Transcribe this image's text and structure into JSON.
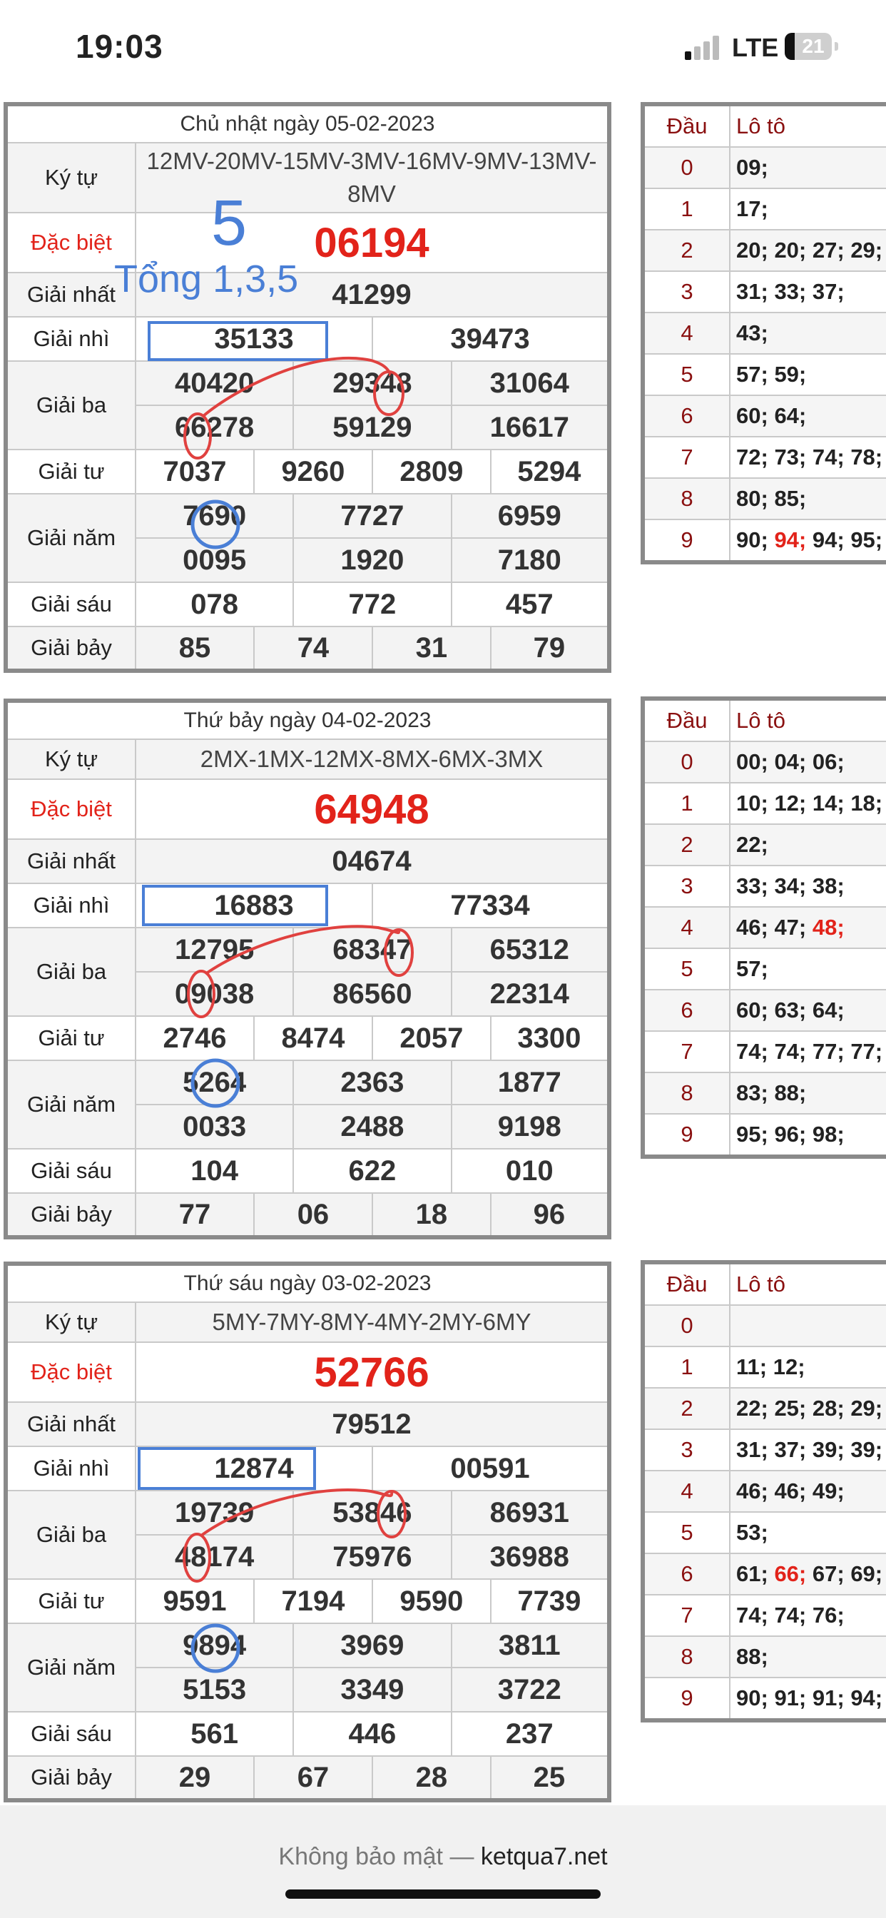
{
  "status_bar": {
    "time": "19:03",
    "network": "LTE",
    "battery": "21"
  },
  "labels": {
    "ky_tu": "Ký tự",
    "dac_biet": "Đặc biệt",
    "giai_nhat": "Giải nhất",
    "giai_nhi": "Giải nhì",
    "giai_ba": "Giải ba",
    "giai_tu": "Giải tư",
    "giai_nam": "Giải năm",
    "giai_sau": "Giải sáu",
    "giai_bay": "Giải bảy",
    "dau": "Đầu",
    "loto": "Lô tô"
  },
  "annotations": {
    "big_number": "5",
    "tong": "Tổng 1,3,5"
  },
  "days": [
    {
      "title": "Chủ nhật ngày 05-02-2023",
      "ky_tu": "12MV-20MV-15MV-3MV-16MV-9MV-13MV-8MV",
      "dac_biet": "06194",
      "giai_nhat": "41299",
      "giai_nhi": [
        "35133",
        "39473"
      ],
      "giai_ba": [
        "40420",
        "29348",
        "31064",
        "66278",
        "59129",
        "16617"
      ],
      "giai_tu": [
        "7037",
        "9260",
        "2809",
        "5294"
      ],
      "giai_nam": [
        "7690",
        "7727",
        "6959",
        "0095",
        "1920",
        "7180"
      ],
      "giai_sau": [
        "078",
        "772",
        "457"
      ],
      "giai_bay": [
        "85",
        "74",
        "31",
        "79"
      ],
      "loto": [
        {
          "dau": "0",
          "values": [
            "09;"
          ]
        },
        {
          "dau": "1",
          "values": [
            "17;"
          ]
        },
        {
          "dau": "2",
          "values": [
            "20;",
            "20;",
            "27;",
            "29;"
          ]
        },
        {
          "dau": "3",
          "values": [
            "31;",
            "33;",
            "37;"
          ]
        },
        {
          "dau": "4",
          "values": [
            "43;"
          ]
        },
        {
          "dau": "5",
          "values": [
            "57;",
            "59;"
          ]
        },
        {
          "dau": "6",
          "values": [
            "60;",
            "64;"
          ]
        },
        {
          "dau": "7",
          "values": [
            "72;",
            "73;",
            "74;",
            "78;"
          ]
        },
        {
          "dau": "8",
          "values": [
            "80;",
            "85;"
          ]
        },
        {
          "dau": "9",
          "values": [
            "90;",
            "94;",
            "94;",
            "95;"
          ],
          "hot": [
            1
          ]
        }
      ]
    },
    {
      "title": "Thứ bảy ngày 04-02-2023",
      "ky_tu": "2MX-1MX-12MX-8MX-6MX-3MX",
      "dac_biet": "64948",
      "giai_nhat": "04674",
      "giai_nhi": [
        "16883",
        "77334"
      ],
      "giai_ba": [
        "12795",
        "68347",
        "65312",
        "09038",
        "86560",
        "22314"
      ],
      "giai_tu": [
        "2746",
        "8474",
        "2057",
        "3300"
      ],
      "giai_nam": [
        "5264",
        "2363",
        "1877",
        "0033",
        "2488",
        "9198"
      ],
      "giai_sau": [
        "104",
        "622",
        "010"
      ],
      "giai_bay": [
        "77",
        "06",
        "18",
        "96"
      ],
      "loto": [
        {
          "dau": "0",
          "values": [
            "00;",
            "04;",
            "06;"
          ]
        },
        {
          "dau": "1",
          "values": [
            "10;",
            "12;",
            "14;",
            "18;"
          ]
        },
        {
          "dau": "2",
          "values": [
            "22;"
          ]
        },
        {
          "dau": "3",
          "values": [
            "33;",
            "34;",
            "38;"
          ]
        },
        {
          "dau": "4",
          "values": [
            "46;",
            "47;",
            "48;"
          ],
          "hot": [
            2
          ]
        },
        {
          "dau": "5",
          "values": [
            "57;"
          ]
        },
        {
          "dau": "6",
          "values": [
            "60;",
            "63;",
            "64;"
          ]
        },
        {
          "dau": "7",
          "values": [
            "74;",
            "74;",
            "77;",
            "77;"
          ]
        },
        {
          "dau": "8",
          "values": [
            "83;",
            "88;"
          ]
        },
        {
          "dau": "9",
          "values": [
            "95;",
            "96;",
            "98;"
          ]
        }
      ]
    },
    {
      "title": "Thứ sáu ngày 03-02-2023",
      "ky_tu": "5MY-7MY-8MY-4MY-2MY-6MY",
      "dac_biet": "52766",
      "giai_nhat": "79512",
      "giai_nhi": [
        "12874",
        "00591"
      ],
      "giai_ba": [
        "19739",
        "53846",
        "86931",
        "48174",
        "75976",
        "36988"
      ],
      "giai_tu": [
        "9591",
        "7194",
        "9590",
        "7739"
      ],
      "giai_nam": [
        "9894",
        "3969",
        "3811",
        "5153",
        "3349",
        "3722"
      ],
      "giai_sau": [
        "561",
        "446",
        "237"
      ],
      "giai_bay": [
        "29",
        "67",
        "28",
        "25"
      ],
      "loto": [
        {
          "dau": "0",
          "values": []
        },
        {
          "dau": "1",
          "values": [
            "11;",
            "12;"
          ]
        },
        {
          "dau": "2",
          "values": [
            "22;",
            "25;",
            "28;",
            "29;"
          ]
        },
        {
          "dau": "3",
          "values": [
            "31;",
            "37;",
            "39;",
            "39;"
          ]
        },
        {
          "dau": "4",
          "values": [
            "46;",
            "46;",
            "49;"
          ]
        },
        {
          "dau": "5",
          "values": [
            "53;"
          ]
        },
        {
          "dau": "6",
          "values": [
            "61;",
            "66;",
            "67;",
            "69;"
          ],
          "hot": [
            1
          ]
        },
        {
          "dau": "7",
          "values": [
            "74;",
            "74;",
            "76;"
          ]
        },
        {
          "dau": "8",
          "values": [
            "88;"
          ]
        },
        {
          "dau": "9",
          "values": [
            "90;",
            "91;",
            "91;",
            "94;"
          ]
        }
      ]
    }
  ],
  "footer": {
    "prefix": "Không bảo mật — ",
    "site": "ketqua7.net"
  },
  "colors": {
    "special": "#e2231a",
    "label_dau": "#8a1010",
    "annotation_blue": "#4a7fd6",
    "annotation_red": "#e0413f"
  }
}
